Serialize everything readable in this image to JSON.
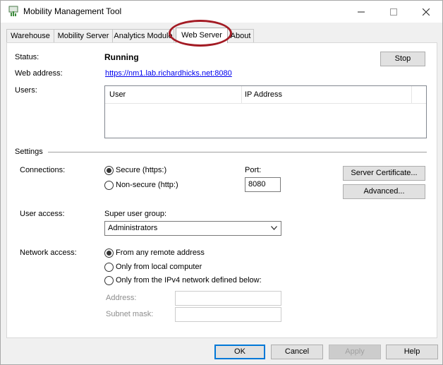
{
  "window": {
    "title": "Mobility Management Tool"
  },
  "tabs": [
    "Warehouse",
    "Mobility Server",
    "Analytics Module",
    "Web Server",
    "About"
  ],
  "server": {
    "status_label": "Status:",
    "status_value": "Running",
    "stop_label": "Stop",
    "webaddr_label": "Web address:",
    "webaddr_value": "https://nm1.lab.richardhicks.net:8080",
    "users_label": "Users:",
    "users_columns": [
      "User",
      "IP Address"
    ]
  },
  "settings": {
    "heading": "Settings",
    "connections_label": "Connections:",
    "secure_label": "Secure (https:)",
    "nonsecure_label": "Non-secure (http:)",
    "port_label": "Port:",
    "port_value": "8080",
    "cert_button": "Server Certificate...",
    "advanced_button": "Advanced...",
    "user_access_label": "User access:",
    "super_user_label": "Super user group:",
    "super_user_value": "Administrators",
    "network_access_label": "Network access:",
    "net_any": "From any remote address",
    "net_local": "Only from local computer",
    "net_ipv4": "Only from the IPv4 network defined below:",
    "address_label": "Address:",
    "subnet_label": "Subnet mask:"
  },
  "footer": {
    "ok": "OK",
    "cancel": "Cancel",
    "apply": "Apply",
    "help": "Help"
  }
}
